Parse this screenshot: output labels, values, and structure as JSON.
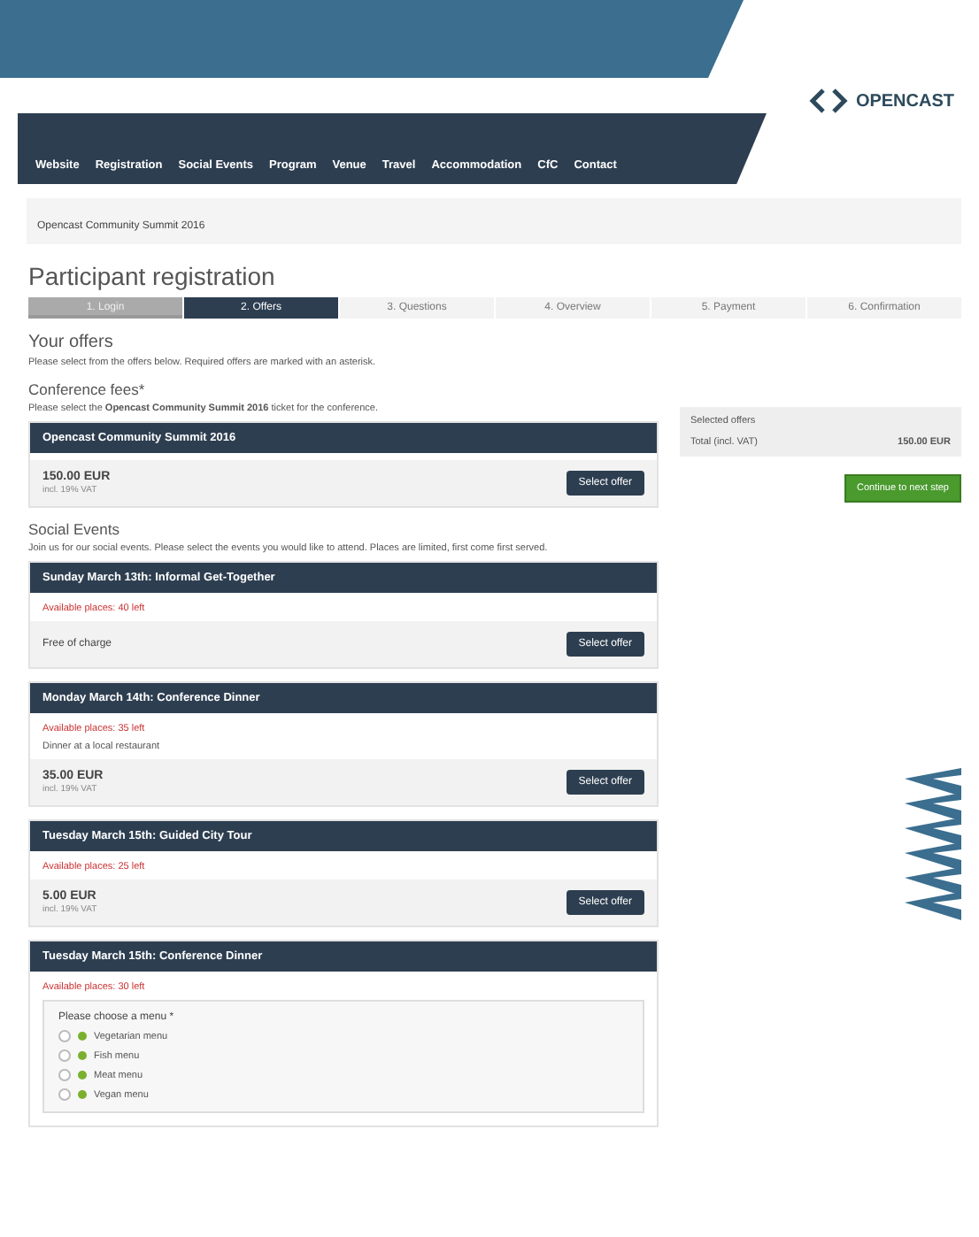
{
  "logo": {
    "text": "OPENCAST"
  },
  "nav": [
    "Website",
    "Registration",
    "Social Events",
    "Program",
    "Venue",
    "Travel",
    "Accommodation",
    "CfC",
    "Contact"
  ],
  "breadcrumb": "Opencast Community Summit 2016",
  "title": "Participant registration",
  "steps": [
    {
      "label": "1. Login",
      "done": true,
      "selected": false
    },
    {
      "label": "2. Offers",
      "done": false,
      "selected": true
    },
    {
      "label": "3. Questions",
      "done": false,
      "selected": false
    },
    {
      "label": "4. Overview",
      "done": false,
      "selected": false
    },
    {
      "label": "5. Payment",
      "done": false,
      "selected": false
    },
    {
      "label": "6. Confirmation",
      "done": false,
      "selected": false
    }
  ],
  "offers_heading": "Your offers",
  "offers_intro": "Please select from the offers below. Required offers are marked with an asterisk.",
  "sections": [
    {
      "heading": "Conference fees*",
      "intro": "Please select the **Opencast Community Summit 2016** ticket for the conference.",
      "cards": [
        {
          "title": "Opencast Community Summit 2016",
          "price": "150.00 EUR",
          "price_note": "incl. 19% VAT",
          "button": "Select offer"
        }
      ]
    },
    {
      "heading": "Social Events",
      "intro": "Join us for our social events. Please select the events you would like to attend. Places are limited, first come first served.",
      "cards": [
        {
          "title": "Sunday March 13th: Informal Get-Together",
          "availability": "Available places: 40 left",
          "free": "Free of charge",
          "button": "Select offer"
        },
        {
          "title": "Monday March 14th: Conference Dinner",
          "availability": "Available places: 35 left",
          "option": "Dinner at a local restaurant",
          "price": "35.00 EUR",
          "price_note": "incl. 19% VAT",
          "button": "Select offer"
        },
        {
          "title": "Tuesday March 15th: Guided City Tour",
          "availability": "Available places: 25 left",
          "price": "5.00 EUR",
          "price_note": "incl. 19% VAT",
          "button": "Select offer"
        },
        {
          "title": "Tuesday March 15th: Conference Dinner",
          "availability": "Available places: 30 left",
          "choices_label": "Please choose a menu *",
          "choices": [
            {
              "label": "Vegetarian menu",
              "selected": false
            },
            {
              "label": "Fish menu",
              "selected": false
            },
            {
              "label": "Meat menu",
              "selected": false
            },
            {
              "label": "Vegan menu",
              "selected": false
            }
          ]
        }
      ]
    }
  ],
  "summary": {
    "heading": "Selected offers",
    "total_label": "Total (incl. VAT)",
    "total": "150.00 EUR",
    "button": "Continue to next step"
  }
}
